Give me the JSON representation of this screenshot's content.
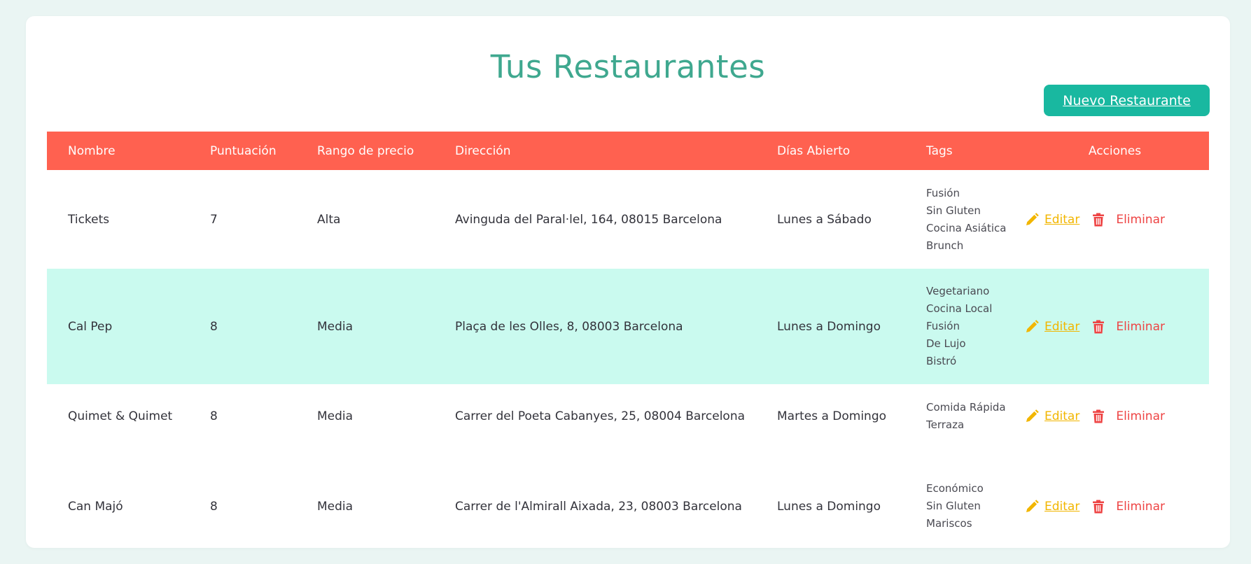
{
  "page": {
    "title": "Tus Restaurantes",
    "new_button": "Nuevo Restaurante"
  },
  "colors": {
    "header_bg": "#ff6150",
    "accent": "#19b8a0",
    "title": "#3fa88f",
    "highlight_row": "#cafaef",
    "edit": "#f2b600",
    "delete": "#ee4444"
  },
  "table": {
    "headers": [
      "Nombre",
      "Puntuación",
      "Rango de precio",
      "Dirección",
      "Días Abierto",
      "Tags",
      "Acciones"
    ],
    "edit_label": "Editar",
    "delete_label": "Eliminar",
    "edit_icon": "pencil-icon",
    "delete_icon": "trash-icon",
    "rows": [
      {
        "nombre": "Tickets",
        "puntuacion": "7",
        "rango": "Alta",
        "direccion": "Avinguda del Paral·lel, 164, 08015 Barcelona",
        "dias": "Lunes a Sábado",
        "tags": [
          "Fusión",
          "Sin Gluten",
          "Cocina Asiática",
          "Brunch"
        ]
      },
      {
        "nombre": "Cal Pep",
        "puntuacion": "8",
        "rango": "Media",
        "direccion": "Plaça de les Olles, 8, 08003 Barcelona",
        "dias": "Lunes a Domingo",
        "tags": [
          "Vegetariano",
          "Cocina Local",
          "Fusión",
          "De Lujo",
          "Bistró"
        ]
      },
      {
        "nombre": "Quimet & Quimet",
        "puntuacion": "8",
        "rango": "Media",
        "direccion": "Carrer del Poeta Cabanyes, 25, 08004 Barcelona",
        "dias": "Martes a Domingo",
        "tags": [
          "Comida Rápida",
          "Terraza"
        ]
      },
      {
        "nombre": "Can Majó",
        "puntuacion": "8",
        "rango": "Media",
        "direccion": "Carrer de l'Almirall Aixada, 23, 08003 Barcelona",
        "dias": "Lunes a Domingo",
        "tags": [
          "Económico",
          "Sin Gluten",
          "Mariscos"
        ]
      }
    ]
  }
}
